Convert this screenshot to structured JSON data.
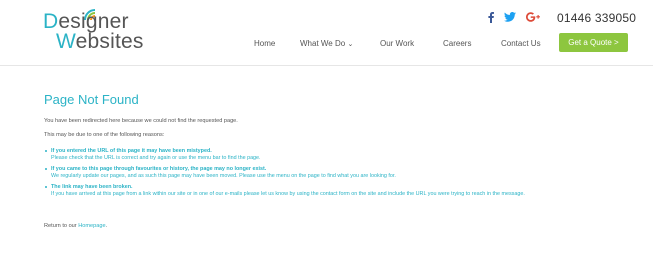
{
  "logo": {
    "line1": "Designer",
    "line2": "Websites"
  },
  "social": {
    "icons": [
      "facebook-icon",
      "twitter-icon",
      "google-plus-icon"
    ]
  },
  "contact": {
    "phone": "01446 339050"
  },
  "nav": {
    "items": [
      {
        "label": "Home"
      },
      {
        "label": "What We Do"
      },
      {
        "label": "Our Work"
      },
      {
        "label": "Careers"
      },
      {
        "label": "Contact Us"
      }
    ],
    "cta": "Get a Quote >"
  },
  "main": {
    "title": "Page Not Found",
    "intro": "You have been redirected here because we could not find the requested page.",
    "reasons_intro": "This may be due to one of the following reasons:",
    "reasons": [
      {
        "title": "If you entered the URL of this page it may have been mistyped.",
        "desc": "Please check that the URL is correct and try again or use the menu bar to find the page."
      },
      {
        "title": "If you came to this page through favourites or history, the page may no longer exist.",
        "desc": "We regularly update our pages, and as such this page may have been moved. Please use the menu on the page to find what you are looking for."
      },
      {
        "title": "The link may have been broken.",
        "desc": "If you have arrived at this page from a link within our site or in one of our e-mails please let us know by using the contact form on the site and include the URL you were trying to reach in the message."
      }
    ],
    "return_prefix": "Return to our ",
    "return_link": "Homepage",
    "return_suffix": "."
  },
  "colors": {
    "accent": "#2bb3c6",
    "cta": "#8dc63f",
    "facebook": "#3b5998",
    "twitter": "#1da1f2",
    "google": "#dd4b39"
  }
}
